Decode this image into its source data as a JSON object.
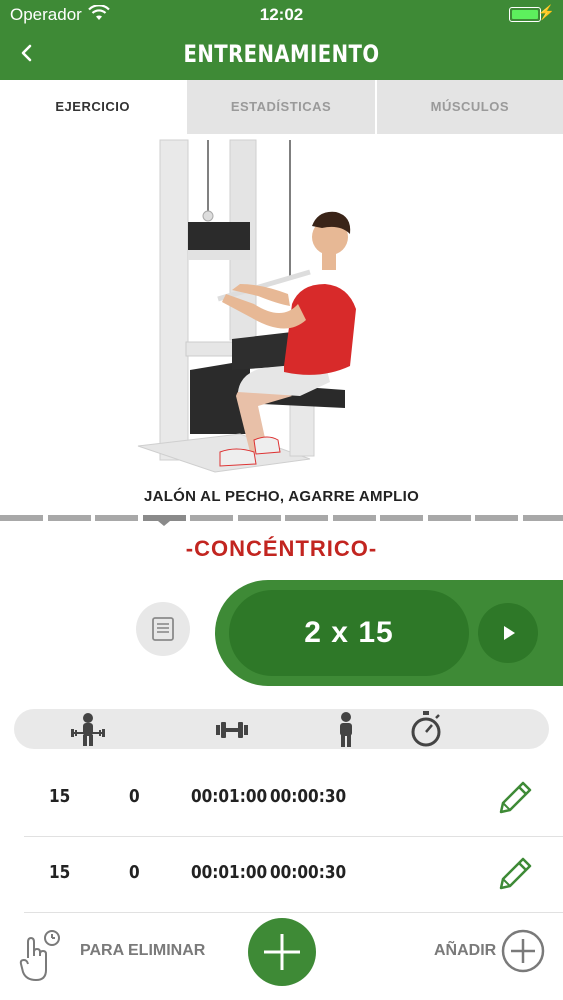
{
  "status_bar": {
    "carrier": "Operador",
    "time": "12:02"
  },
  "nav": {
    "title": "ENTRENAMIENTO",
    "back_icon": "chevron-left-icon"
  },
  "tabs": [
    {
      "label": "EJERCICIO",
      "active": true
    },
    {
      "label": "ESTADÍSTICAS",
      "active": false
    },
    {
      "label": "MÚSCULOS",
      "active": false
    }
  ],
  "exercise": {
    "name": "JALÓN AL PECHO, AGARRE AMPLIO",
    "phase": "-CONCÉNTRICO-",
    "reps": "2 x 15"
  },
  "columns": {
    "icons": [
      "weightlifter-icon",
      "dumbbell-icon",
      "person-icon",
      "stopwatch-icon"
    ]
  },
  "sets": [
    {
      "reps": "15",
      "weight": "0",
      "time": "00:01:00",
      "rest": "00:00:30"
    },
    {
      "reps": "15",
      "weight": "0",
      "time": "00:01:00",
      "rest": "00:00:30"
    }
  ],
  "bottom": {
    "delete_label": "PARA ELIMINAR",
    "add_label": "AÑADIR"
  },
  "colors": {
    "primary": "#3e8a36",
    "primary_dark": "#2e7828",
    "accent_red": "#c22520"
  }
}
